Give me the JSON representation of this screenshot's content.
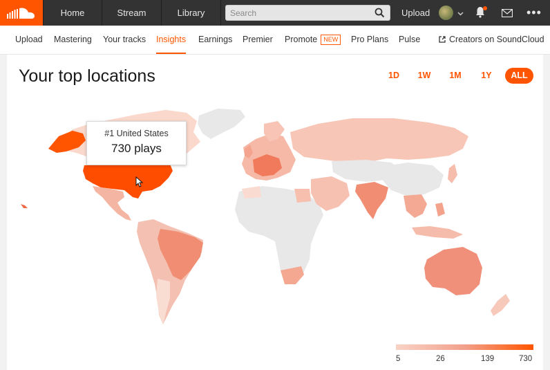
{
  "header": {
    "logo_icon": "soundcloud-logo-icon",
    "nav": [
      "Home",
      "Stream",
      "Library"
    ],
    "search_placeholder": "Search",
    "upload_label": "Upload",
    "more_label": "•••"
  },
  "subnav": {
    "items": [
      "Upload",
      "Mastering",
      "Your tracks",
      "Insights",
      "Earnings",
      "Premier",
      "Promote",
      "Pro Plans",
      "Pulse",
      "Creators on SoundCloud"
    ],
    "active": "Insights",
    "new_badge": "NEW"
  },
  "main": {
    "title": "Your top locations",
    "ranges": [
      "1D",
      "1W",
      "1M",
      "1Y",
      "ALL"
    ],
    "selected_range": "ALL",
    "tooltip": {
      "rank_label": "#1 United States",
      "plays_label": "730 plays"
    },
    "legend": {
      "ticks": [
        "5",
        "26",
        "139",
        "730"
      ]
    }
  },
  "colors": {
    "accent": "#ff5500",
    "topbar": "#333333",
    "land_empty": "#e8e8e8"
  }
}
